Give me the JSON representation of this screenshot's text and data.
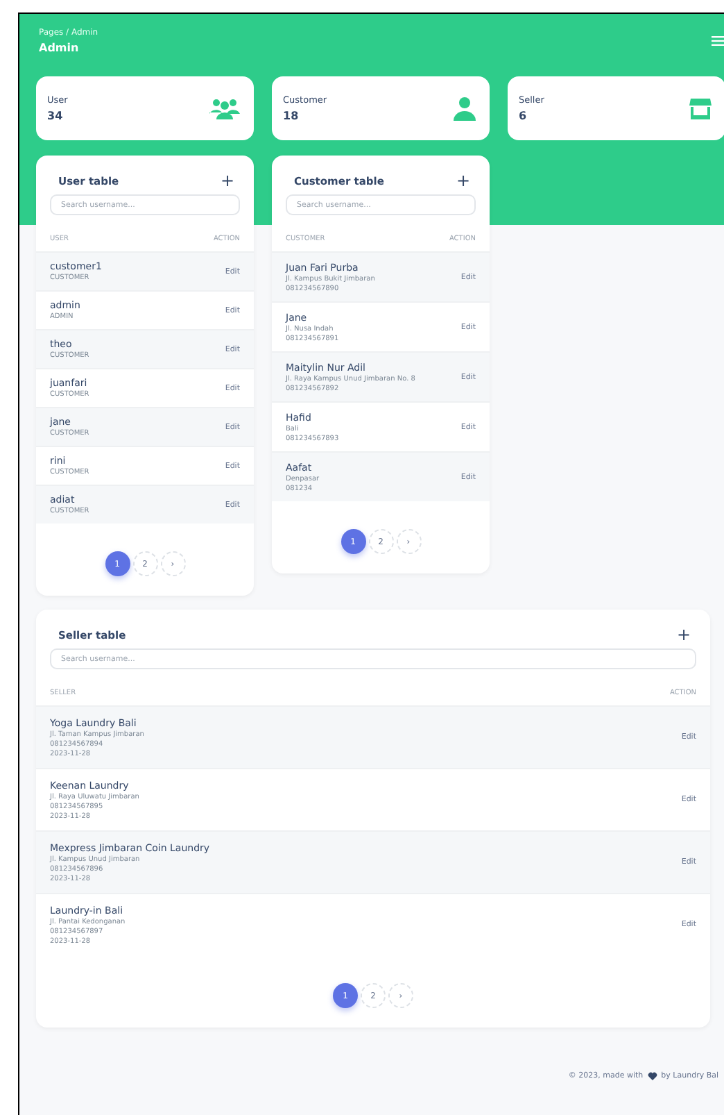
{
  "header": {
    "breadcrumb": "Pages / Admin",
    "title": "Admin"
  },
  "stats": [
    {
      "label": "User",
      "value": "34",
      "kind": "users"
    },
    {
      "label": "Customer",
      "value": "18",
      "kind": "user"
    },
    {
      "label": "Seller",
      "value": "6",
      "kind": "store"
    }
  ],
  "user_table": {
    "title": "User table",
    "add": "+",
    "search": {
      "placeholder": "Search username..."
    },
    "columns": [
      "USER",
      "ACTION"
    ],
    "rows": [
      {
        "name": "customer1",
        "lines": [
          "CUSTOMER"
        ],
        "action": "Edit"
      },
      {
        "name": "admin",
        "lines": [
          "ADMIN"
        ],
        "action": "Edit"
      },
      {
        "name": "theo",
        "lines": [
          "CUSTOMER"
        ],
        "action": "Edit"
      },
      {
        "name": "juanfari",
        "lines": [
          "CUSTOMER"
        ],
        "action": "Edit"
      },
      {
        "name": "jane",
        "lines": [
          "CUSTOMER"
        ],
        "action": "Edit"
      },
      {
        "name": "rini",
        "lines": [
          "CUSTOMER"
        ],
        "action": "Edit"
      },
      {
        "name": "adiat",
        "lines": [
          "CUSTOMER"
        ],
        "action": "Edit"
      }
    ],
    "pages": [
      {
        "label": "1",
        "selected": true
      },
      {
        "label": "2",
        "selected": false
      },
      {
        "label": "›",
        "selected": false
      }
    ]
  },
  "customer_table": {
    "title": "Customer table",
    "add": "+",
    "search": {
      "placeholder": "Search username..."
    },
    "columns": [
      "CUSTOMER",
      "ACTION"
    ],
    "rows": [
      {
        "name": "Juan Fari Purba",
        "lines": [
          "Jl. Kampus Bukit Jimbaran",
          "081234567890"
        ],
        "action": "Edit"
      },
      {
        "name": "Jane",
        "lines": [
          "Jl. Nusa Indah",
          "081234567891"
        ],
        "action": "Edit"
      },
      {
        "name": "Maitylin Nur Adil",
        "lines": [
          "Jl. Raya Kampus Unud Jimbaran No. 8",
          "081234567892"
        ],
        "action": "Edit"
      },
      {
        "name": "Hafid",
        "lines": [
          "Bali",
          "081234567893"
        ],
        "action": "Edit"
      },
      {
        "name": "Aafat",
        "lines": [
          "Denpasar",
          "081234"
        ],
        "action": "Edit"
      }
    ],
    "pages": [
      {
        "label": "1",
        "selected": true
      },
      {
        "label": "2",
        "selected": false
      },
      {
        "label": "›",
        "selected": false
      }
    ]
  },
  "seller_table": {
    "title": "Seller table",
    "add": "+",
    "search": {
      "placeholder": "Search username..."
    },
    "columns": [
      "SELLER",
      "ACTION"
    ],
    "rows": [
      {
        "name": "Yoga Laundry Bali",
        "lines": [
          "Jl. Taman Kampus Jimbaran",
          "081234567894",
          "2023-11-28"
        ],
        "action": "Edit"
      },
      {
        "name": "Keenan Laundry",
        "lines": [
          "Jl. Raya Uluwatu Jimbaran",
          "081234567895",
          "2023-11-28"
        ],
        "action": "Edit"
      },
      {
        "name": "Mexpress Jimbaran Coin Laundry",
        "lines": [
          "Jl. Kampus Unud Jimbaran",
          "081234567896",
          "2023-11-28"
        ],
        "action": "Edit"
      },
      {
        "name": "Laundry-in Bali",
        "lines": [
          "Jl. Pantai Kedonganan",
          "081234567897",
          "2023-11-28"
        ],
        "action": "Edit"
      }
    ],
    "pages": [
      {
        "label": "1",
        "selected": true
      },
      {
        "label": "2",
        "selected": false
      },
      {
        "label": "›",
        "selected": false
      }
    ]
  },
  "footer": {
    "before": "© 2023, made with",
    "after": "by Laundry Bal"
  }
}
